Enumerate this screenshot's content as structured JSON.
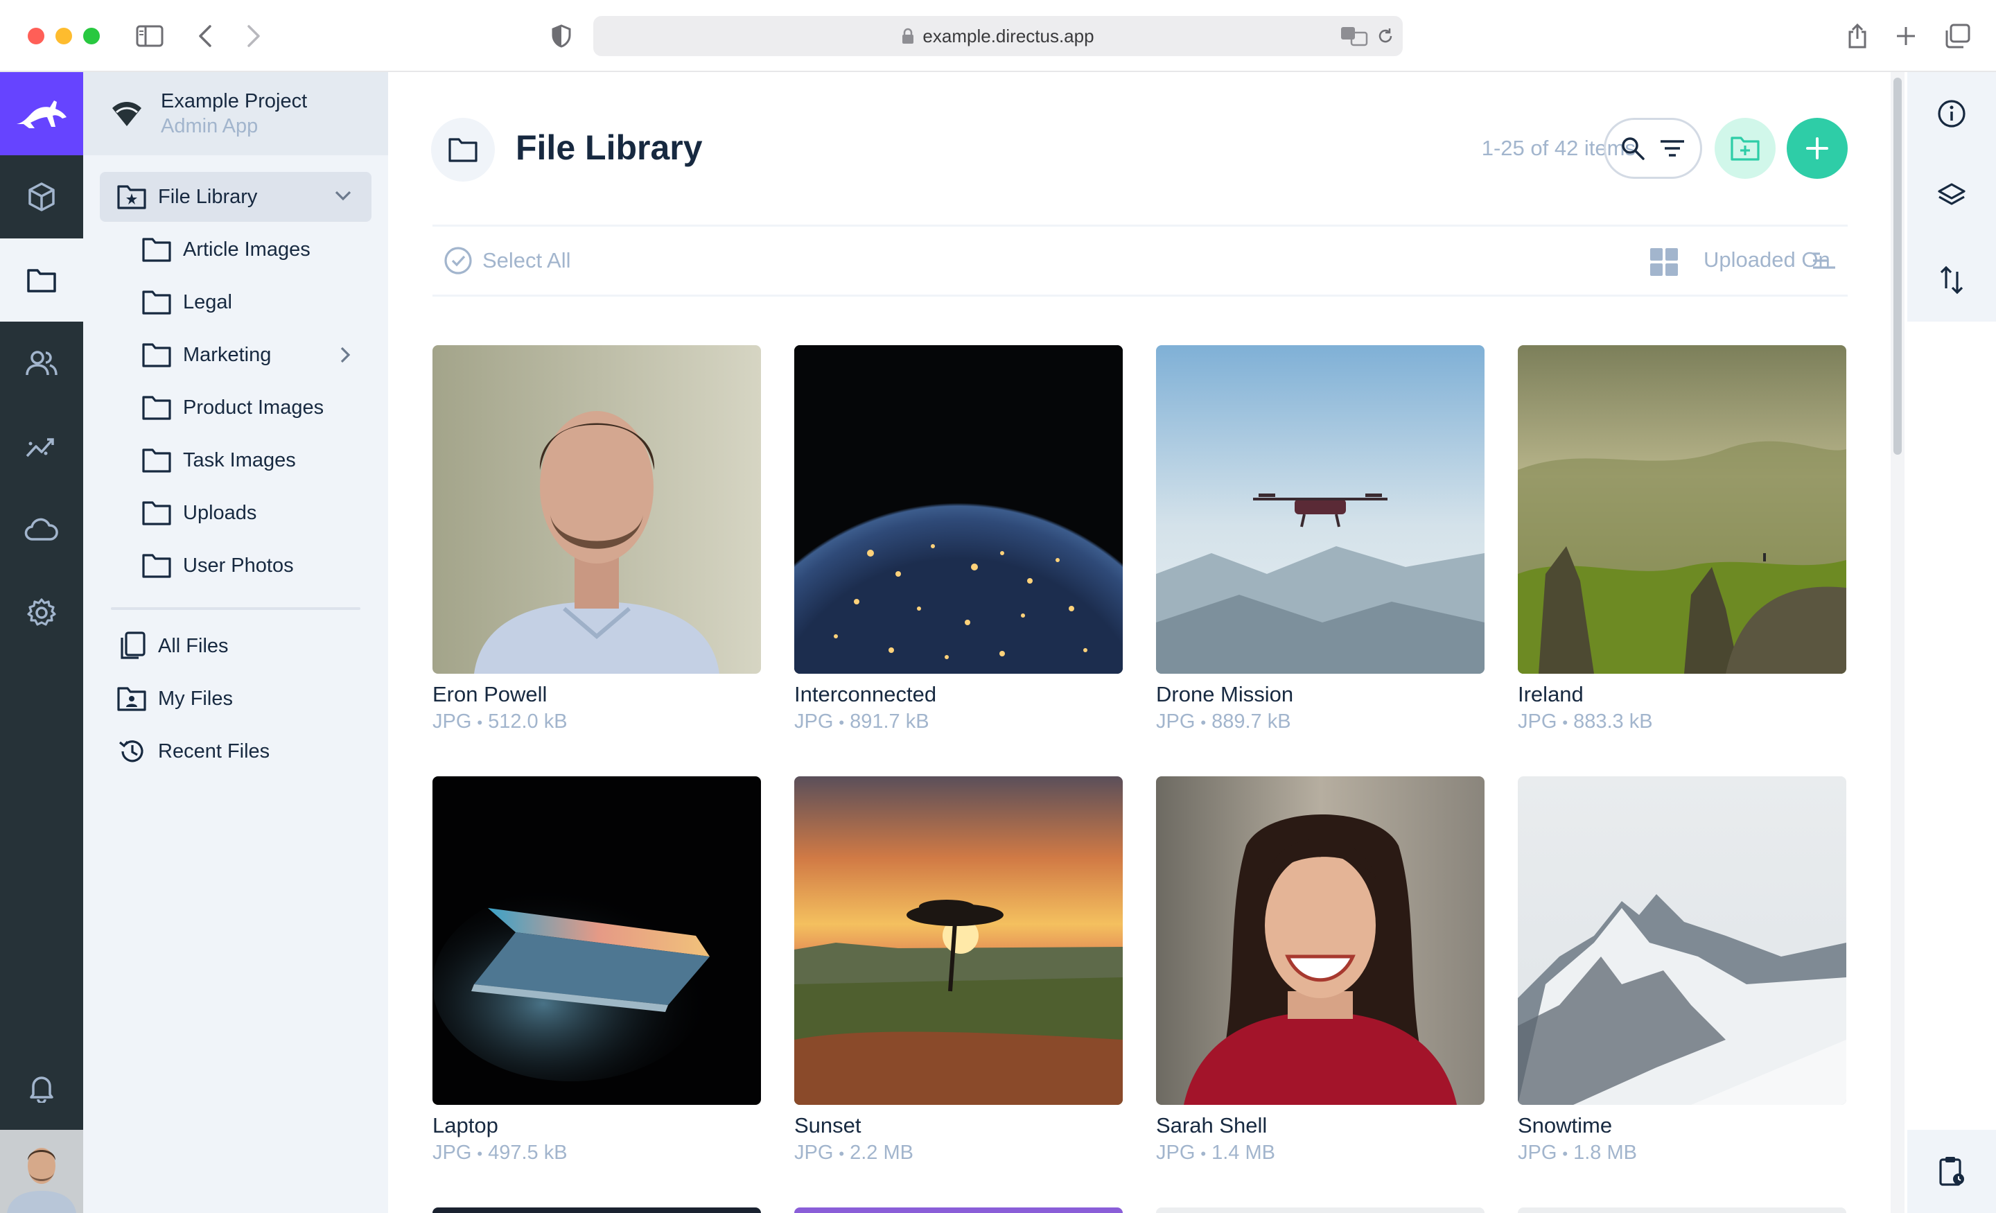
{
  "browser": {
    "url": "example.directus.app"
  },
  "project": {
    "name": "Example Project",
    "subtitle": "Admin App"
  },
  "nav": {
    "root": "File Library",
    "folders": [
      "Article Images",
      "Legal",
      "Marketing",
      "Product Images",
      "Task Images",
      "Uploads",
      "User Photos"
    ],
    "links": [
      "All Files",
      "My Files",
      "Recent Files"
    ]
  },
  "header": {
    "title": "File Library",
    "count": "1-25 of 42 items"
  },
  "toolbar": {
    "select_all": "Select All",
    "sort_field": "Uploaded On"
  },
  "files": [
    {
      "title": "Eron Powell",
      "type": "JPG",
      "size": "512.0 kB"
    },
    {
      "title": "Interconnected",
      "type": "JPG",
      "size": "891.7 kB"
    },
    {
      "title": "Drone Mission",
      "type": "JPG",
      "size": "889.7 kB"
    },
    {
      "title": "Ireland",
      "type": "JPG",
      "size": "883.3 kB"
    },
    {
      "title": "Laptop",
      "type": "JPG",
      "size": "497.5 kB"
    },
    {
      "title": "Sunset",
      "type": "JPG",
      "size": "2.2 MB"
    },
    {
      "title": "Sarah Shell",
      "type": "JPG",
      "size": "1.4 MB"
    },
    {
      "title": "Snowtime",
      "type": "JPG",
      "size": "1.8 MB"
    }
  ],
  "colors": {
    "brand": "#6644ff",
    "primary": "#2ecda7",
    "module_bar": "#263238",
    "nav_bg": "#f0f4f9"
  }
}
